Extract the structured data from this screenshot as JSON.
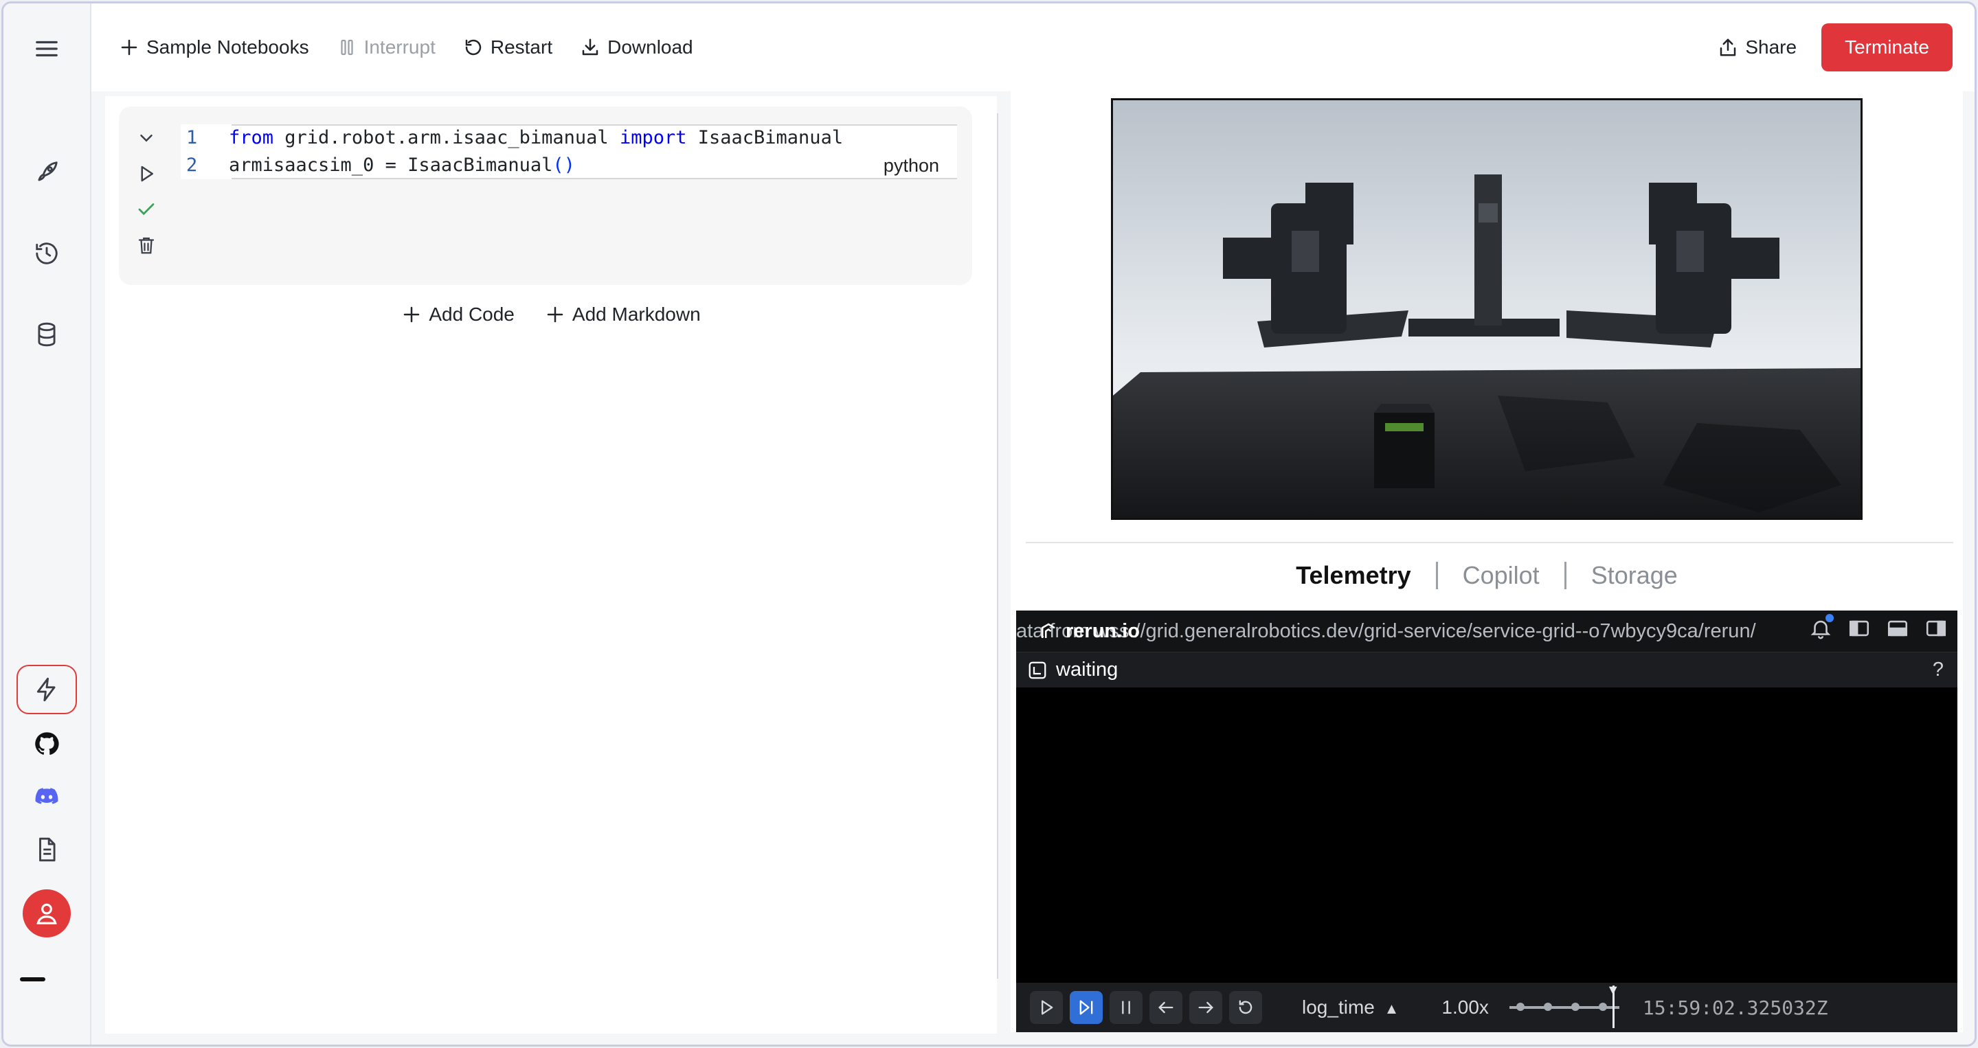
{
  "toolbar": {
    "sample_notebooks": "Sample Notebooks",
    "interrupt": "Interrupt",
    "restart": "Restart",
    "download": "Download",
    "share": "Share",
    "terminate": "Terminate"
  },
  "sidebar": {
    "items": [
      {
        "name": "menu-icon"
      },
      {
        "name": "rocket-icon"
      },
      {
        "name": "history-icon"
      },
      {
        "name": "database-icon"
      },
      {
        "name": "bolt-icon"
      },
      {
        "name": "github-icon"
      },
      {
        "name": "discord-icon"
      },
      {
        "name": "document-icon"
      },
      {
        "name": "user-icon"
      }
    ]
  },
  "cell": {
    "lines": [
      {
        "num": "1",
        "parts": [
          "from",
          " grid.robot.arm.isaac_bimanual ",
          "import",
          " IsaacBimanual"
        ]
      },
      {
        "num": "2",
        "parts": [
          "armisaacsim_0 = IsaacBimanual",
          "()"
        ]
      }
    ],
    "language": "python"
  },
  "notebook": {
    "add_code": "Add Code",
    "add_markdown": "Add Markdown"
  },
  "tabs": [
    {
      "label": "Telemetry",
      "active": true
    },
    {
      "label": "Copilot",
      "active": false
    },
    {
      "label": "Storage",
      "active": false
    }
  ],
  "rerun": {
    "url": "ata from wss://grid.generalrobotics.dev/grid-service/service-grid--o7wbycy9ca/rerun/",
    "logo": "rerun.io",
    "status": "waiting",
    "help": "?",
    "timeline": "log_time",
    "speed": "1.00x",
    "time": "15:59:02.325032Z"
  },
  "colors": {
    "terminate": "#e0353b",
    "active_play": "#2f6fd6"
  }
}
